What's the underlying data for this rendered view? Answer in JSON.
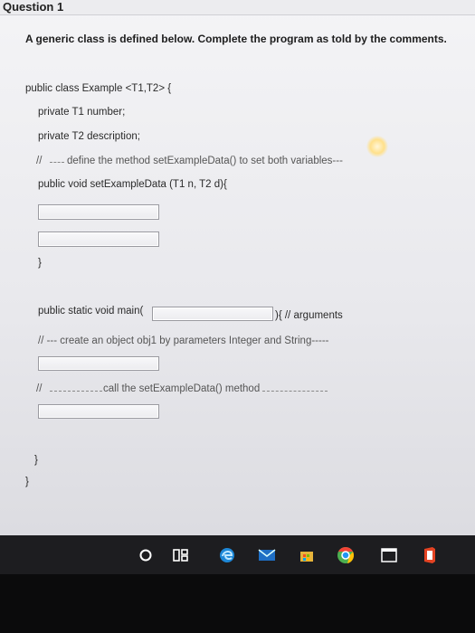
{
  "question": {
    "title": "Question 1"
  },
  "instruction": "A generic class is defined below. Complete the program as told by the comments.",
  "code": {
    "class_decl": "public class Example <T1,T2> {",
    "field_number": "private T1 number;",
    "field_description": "private T2 description;",
    "comment_define_slashes": "//",
    "comment_define": "define the method setExampleData() to set both variables---",
    "method_decl": "public void setExampleData (T1 n, T2 d){",
    "method_close": "}",
    "main_decl": "public static void main(",
    "main_args": "){ // arguments",
    "comment_create": "// --- create an object obj1 by parameters Integer and String-----",
    "comment_call_slashes": "//",
    "comment_call": "call the setExampleData() method",
    "main_close": "}",
    "class_close": "}"
  },
  "taskbar": {
    "icons": [
      "search-icon",
      "task-view-icon",
      "edge-icon",
      "mail-icon",
      "store-icon",
      "chrome-icon",
      "window-icon",
      "office-icon"
    ]
  },
  "colors": {
    "taskbar": "#1d1d20",
    "edge": "#1e88d8",
    "chrome_green": "#4caf50",
    "office": "#e44323"
  }
}
